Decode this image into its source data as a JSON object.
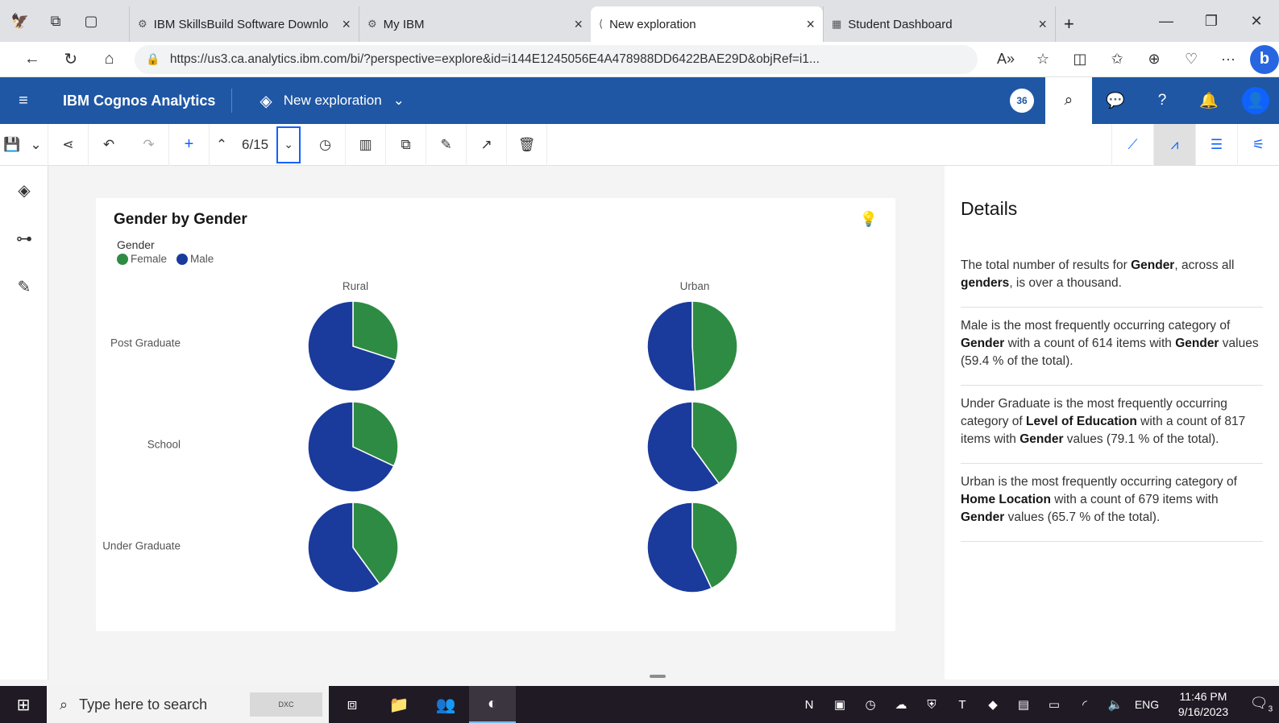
{
  "browser": {
    "tabs": [
      {
        "title": "IBM SkillsBuild Software Downlo",
        "active": false
      },
      {
        "title": "My IBM",
        "active": false
      },
      {
        "title": "New exploration",
        "active": true
      },
      {
        "title": "Student Dashboard",
        "active": false
      }
    ],
    "url": "https://us3.ca.analytics.ibm.com/bi/?perspective=explore&id=i144E1245056E4A478988DD6422BAE29D&objRef=i1..."
  },
  "header": {
    "brand": "IBM Cognos Analytics",
    "exploration": "New exploration",
    "badge": "36"
  },
  "toolbar": {
    "counter": "6/15"
  },
  "chart": {
    "title": "Gender by Gender",
    "legend_title": "Gender",
    "legend": [
      {
        "label": "Female",
        "color": "#2e8b43"
      },
      {
        "label": "Male",
        "color": "#1a3b9c"
      }
    ],
    "columns": [
      "Rural",
      "Urban"
    ],
    "rows": [
      "Post Graduate",
      "School",
      "Under Graduate"
    ]
  },
  "chart_data": {
    "type": "pie",
    "title": "Gender by Gender",
    "legend_title": "Gender",
    "series_names": [
      "Female",
      "Male"
    ],
    "colors": {
      "Female": "#2e8b43",
      "Male": "#1a3b9c"
    },
    "facet_columns": [
      "Rural",
      "Urban"
    ],
    "facet_rows": [
      "Post Graduate",
      "School",
      "Under Graduate"
    ],
    "female_share": {
      "Post Graduate": {
        "Rural": 0.3,
        "Urban": 0.49
      },
      "School": {
        "Rural": 0.32,
        "Urban": 0.4
      },
      "Under Graduate": {
        "Rural": 0.4,
        "Urban": 0.43
      }
    },
    "legend_position": "top-left"
  },
  "details": {
    "title": "Details",
    "insights": [
      {
        "parts": [
          [
            "The total number of results for ",
            false
          ],
          [
            "Gender",
            true
          ],
          [
            ", across all ",
            false
          ],
          [
            "genders",
            true
          ],
          [
            ", is over a thousand.",
            false
          ]
        ]
      },
      {
        "parts": [
          [
            "Male is the most frequently occurring category of ",
            false
          ],
          [
            "Gender",
            true
          ],
          [
            " with a count of 614 items with ",
            false
          ],
          [
            "Gender",
            true
          ],
          [
            " values (59.4 % of the total).",
            false
          ]
        ]
      },
      {
        "parts": [
          [
            "Under Graduate is the most frequently occurring category of ",
            false
          ],
          [
            "Level of Education",
            true
          ],
          [
            " with a count of 817 items with ",
            false
          ],
          [
            "Gender",
            true
          ],
          [
            " values (79.1 % of the total).",
            false
          ]
        ]
      },
      {
        "parts": [
          [
            "Urban is the most frequently occurring category of ",
            false
          ],
          [
            "Home Location",
            true
          ],
          [
            " with a count of 679 items with ",
            false
          ],
          [
            "Gender",
            true
          ],
          [
            " values (65.7 % of the total).",
            false
          ]
        ]
      }
    ]
  },
  "taskbar": {
    "search_placeholder": "Type here to search",
    "lang": "ENG",
    "time": "11:46 PM",
    "date": "9/16/2023",
    "notifications": "3"
  }
}
